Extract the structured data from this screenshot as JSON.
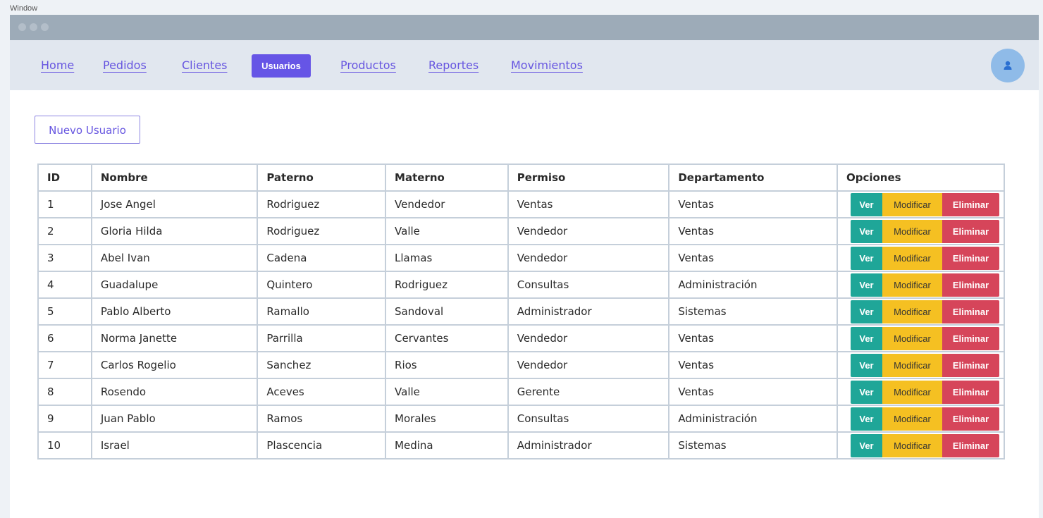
{
  "window": {
    "label": "Window"
  },
  "nav": {
    "links": [
      "Home",
      "Pedidos",
      "Clientes",
      "Usuarios",
      "Productos",
      "Reportes",
      "Movimientos"
    ],
    "active": "Usuarios"
  },
  "toolbar": {
    "new_user_label": "Nuevo Usuario"
  },
  "table": {
    "headers": [
      "ID",
      "Nombre",
      "Paterno",
      "Materno",
      "Permiso",
      "Departamento",
      "Opciones"
    ],
    "action_labels": {
      "view": "Ver",
      "edit": "Modificar",
      "delete": "Eliminar"
    },
    "rows": [
      [
        "1",
        "Jose Angel",
        "Rodriguez",
        "Vendedor",
        "Ventas",
        "Ventas"
      ],
      [
        "2",
        "Gloria Hilda",
        "Rodriguez",
        "Valle",
        "Vendedor",
        "Ventas"
      ],
      [
        "3",
        "Abel Ivan",
        "Cadena",
        "Llamas",
        "Vendedor",
        "Ventas"
      ],
      [
        "4",
        "Guadalupe",
        "Quintero",
        "Rodriguez",
        "Consultas",
        "Administración"
      ],
      [
        "5",
        "Pablo Alberto",
        "Ramallo",
        "Sandoval",
        "Administrador",
        "Sistemas"
      ],
      [
        "6",
        "Norma Janette",
        "Parrilla",
        "Cervantes",
        "Vendedor",
        "Ventas"
      ],
      [
        "7",
        "Carlos Rogelio",
        "Sanchez",
        "Rios",
        "Vendedor",
        "Ventas"
      ],
      [
        "8",
        "Rosendo",
        "Aceves",
        "Valle",
        "Gerente",
        "Ventas"
      ],
      [
        "9",
        "Juan Pablo",
        "Ramos",
        "Morales",
        "Consultas",
        "Administración"
      ],
      [
        "10",
        "Israel",
        "Plascencia",
        "Medina",
        "Administrador",
        "Sistemas"
      ]
    ]
  },
  "icons": {
    "avatar": "user-icon"
  },
  "colors": {
    "accent": "#6655e6",
    "view": "#1fa698",
    "edit": "#f5c022",
    "delete": "#d6455a"
  }
}
